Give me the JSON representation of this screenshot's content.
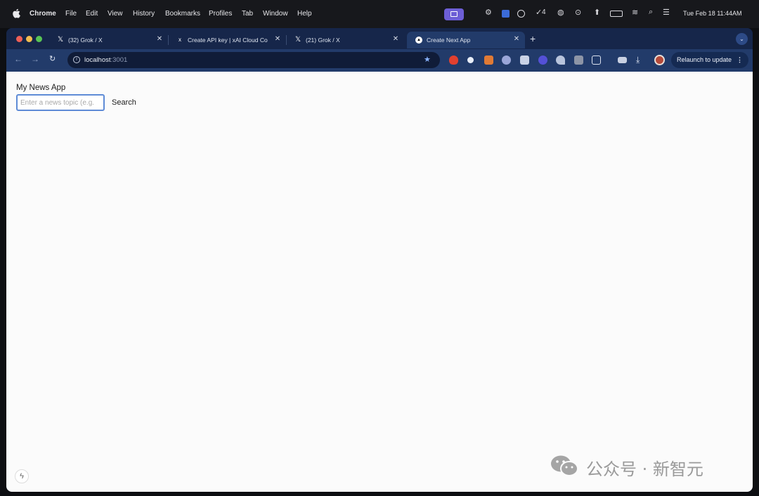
{
  "menubar": {
    "app_name": "Chrome",
    "menus": [
      "File",
      "Edit",
      "View",
      "History",
      "Bookmarks",
      "Profiles",
      "Tab",
      "Window",
      "Help"
    ],
    "status_badge_count": "4",
    "clock": "Tue Feb 18  11:44AM"
  },
  "tabs": [
    {
      "title": "(32) Grok / X",
      "favicon": "x-logo-icon",
      "active": false
    },
    {
      "title": "Create API key | xAI Cloud Co",
      "favicon": "xai-logo-icon",
      "active": false
    },
    {
      "title": "(21) Grok / X",
      "favicon": "x-logo-icon",
      "active": false
    },
    {
      "title": "Create Next App",
      "favicon": "nextjs-logo-icon",
      "active": true
    }
  ],
  "address_bar": {
    "host": "localhost",
    "port": ":3001"
  },
  "toolbar": {
    "relaunch_label": "Relaunch to update"
  },
  "page": {
    "heading": "My News App",
    "search_placeholder": "Enter a news topic (e.g.",
    "search_value": "",
    "search_button_label": "Search"
  },
  "watermark": {
    "text": "公众号 · 新智元"
  },
  "colors": {
    "menubar_bg": "#17181c",
    "tabstrip_bg": "#16264a",
    "toolbar_bg": "#223b6a",
    "page_bg": "#fbfbfb",
    "input_focus_border": "#5e8bd6"
  }
}
